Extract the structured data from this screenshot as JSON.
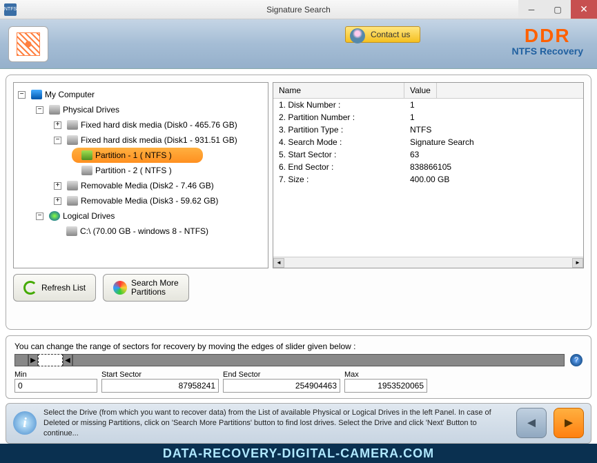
{
  "window": {
    "title": "Signature Search"
  },
  "header": {
    "contact": "Contact us",
    "brand": "DDR",
    "product": "NTFS Recovery"
  },
  "tree": {
    "root": "My Computer",
    "physical": "Physical Drives",
    "disk0": "Fixed hard disk media (Disk0 - 465.76 GB)",
    "disk1": "Fixed hard disk media (Disk1 - 931.51 GB)",
    "part1": "Partition - 1 ( NTFS )",
    "part2": "Partition - 2 ( NTFS )",
    "disk2": "Removable Media (Disk2 - 7.46 GB)",
    "disk3": "Removable Media (Disk3 - 59.62 GB)",
    "logical": "Logical Drives",
    "cdrive": "C:\\ (70.00 GB - windows 8 - NTFS)"
  },
  "details": {
    "col_name": "Name",
    "col_value": "Value",
    "rows": [
      {
        "name": "1. Disk Number :",
        "value": "1"
      },
      {
        "name": "2. Partition Number :",
        "value": "1"
      },
      {
        "name": "3. Partition Type :",
        "value": "NTFS"
      },
      {
        "name": "4. Search Mode :",
        "value": "Signature Search"
      },
      {
        "name": "5. Start Sector :",
        "value": "63"
      },
      {
        "name": "6. End Sector :",
        "value": "838866105"
      },
      {
        "name": "7. Size :",
        "value": "400.00 GB"
      }
    ]
  },
  "buttons": {
    "refresh": "Refresh List",
    "search_more": "Search More\nPartitions"
  },
  "sector": {
    "label": "You can change the range of sectors for recovery by moving the edges of slider given below :",
    "min_label": "Min",
    "min": "0",
    "start_label": "Start Sector",
    "start": "87958241",
    "end_label": "End Sector",
    "end": "254904463",
    "max_label": "Max",
    "max": "1953520065"
  },
  "footer": {
    "text": "Select the Drive (from which you want to recover data) from the List of available Physical or Logical Drives in the left Panel. In case of Deleted or missing Partitions, click on 'Search More Partitions' button to find lost drives. Select the Drive and click 'Next' Button to continue..."
  },
  "watermark": "DATA-RECOVERY-DIGITAL-CAMERA.COM"
}
